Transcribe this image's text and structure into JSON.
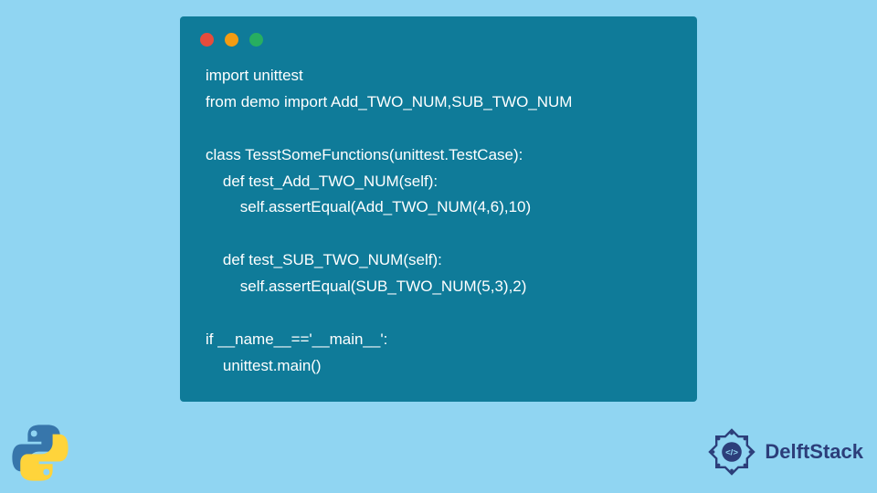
{
  "code": {
    "lines": [
      "import unittest",
      "from demo import Add_TWO_NUM,SUB_TWO_NUM",
      "",
      "class TesstSomeFunctions(unittest.TestCase):",
      "    def test_Add_TWO_NUM(self):",
      "        self.assertEqual(Add_TWO_NUM(4,6),10)",
      "",
      "    def test_SUB_TWO_NUM(self):",
      "        self.assertEqual(SUB_TWO_NUM(5,3),2)",
      "",
      "if __name__=='__main__':",
      "    unittest.main()"
    ]
  },
  "branding": {
    "site_name": "DelftStack"
  }
}
